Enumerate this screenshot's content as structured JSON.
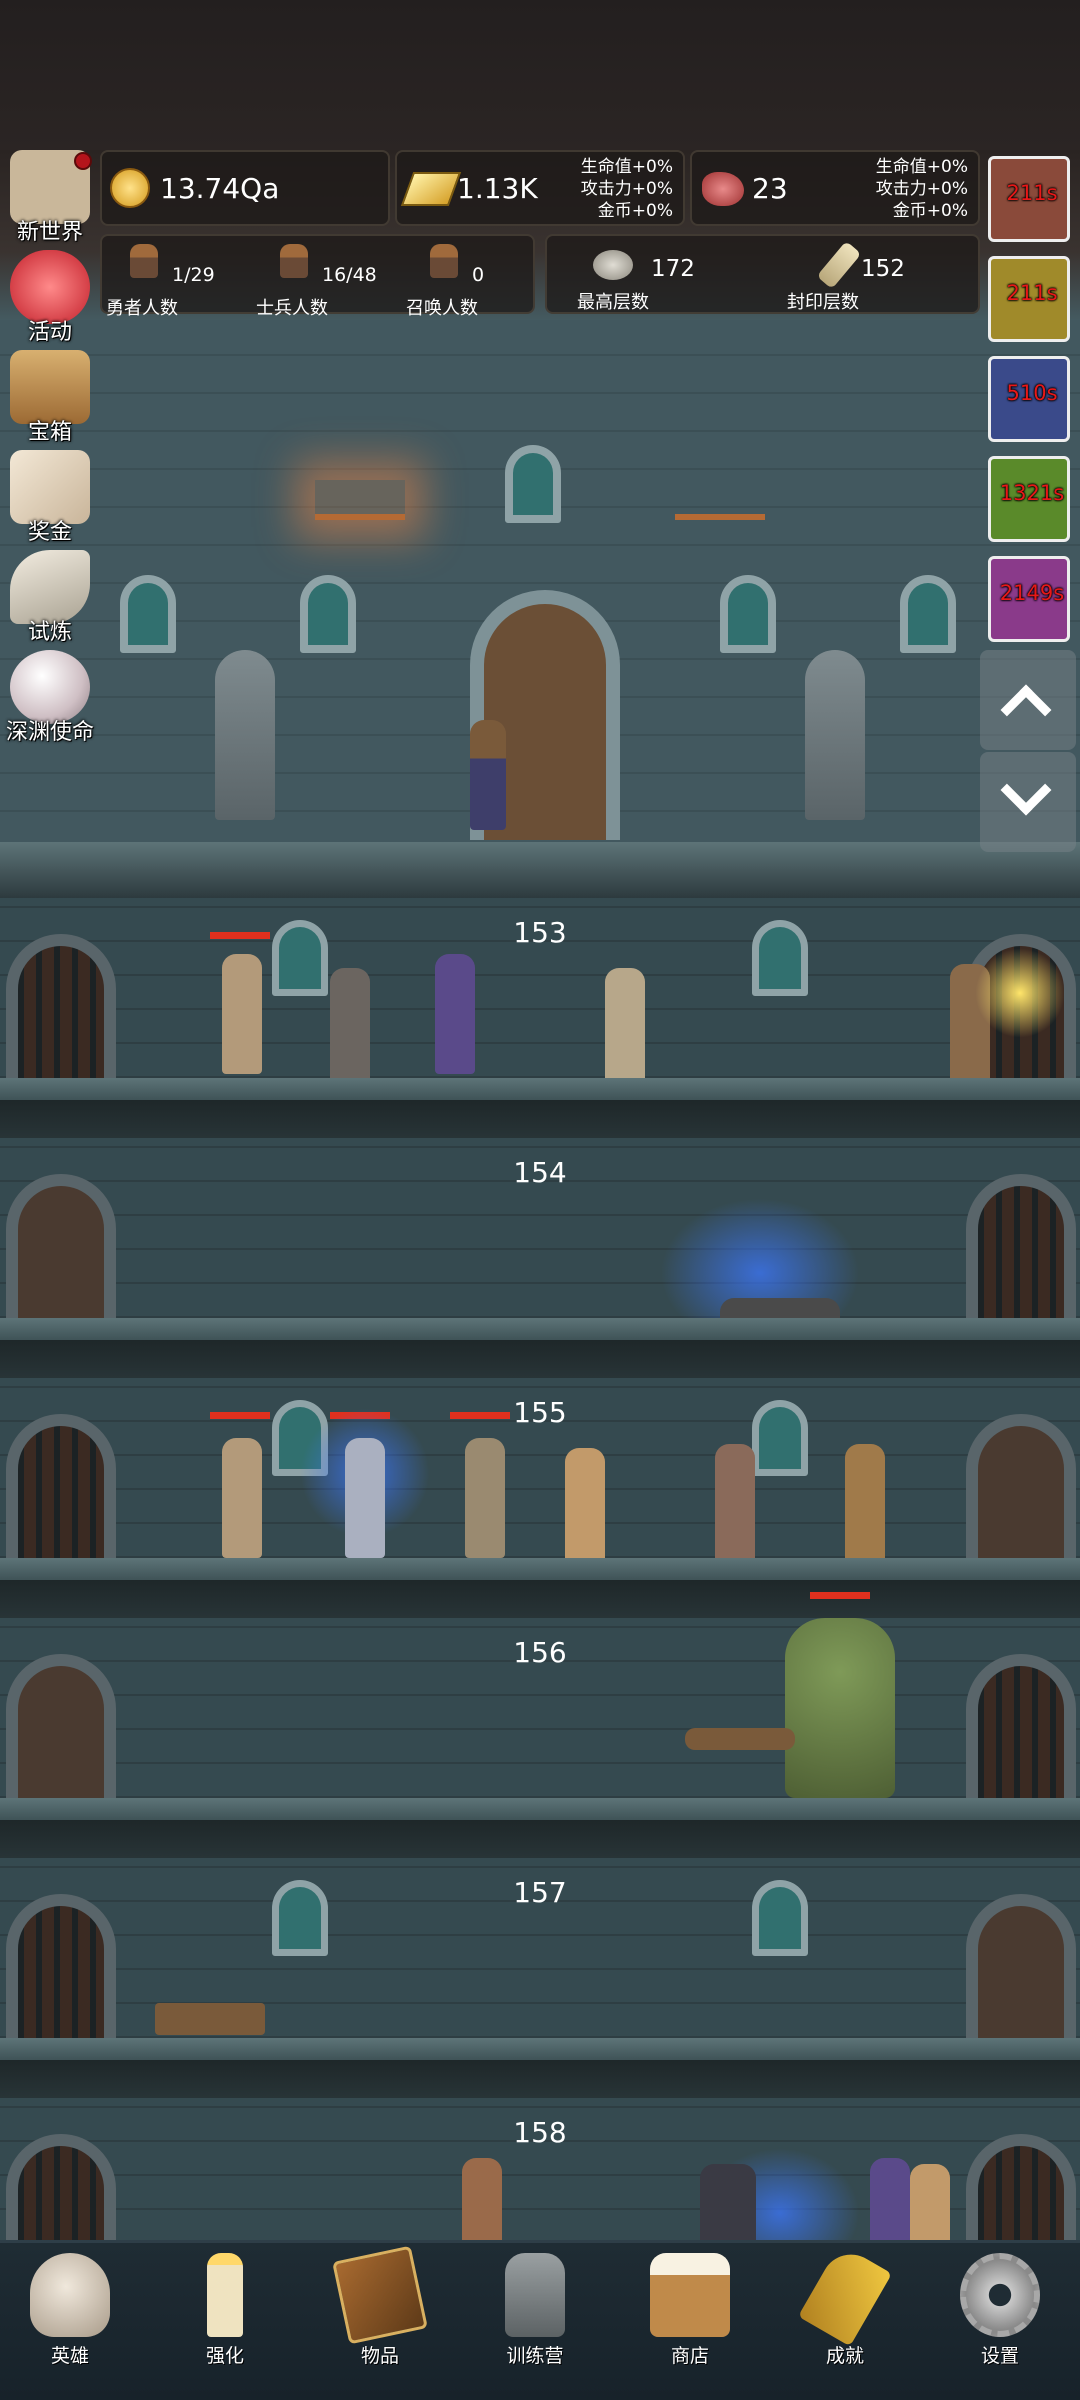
{
  "resources": {
    "coins": "13.74Qa",
    "gold": "1.13K",
    "gold_bonus": [
      "生命值+0%",
      "攻击力+0%",
      "金币+0%"
    ],
    "meat": "23",
    "meat_bonus": [
      "生命值+0%",
      "攻击力+0%",
      "金币+0%"
    ]
  },
  "stats": {
    "heroes": {
      "value": "1/29",
      "label": "勇者人数"
    },
    "soldiers": {
      "value": "16/48",
      "label": "士兵人数"
    },
    "summons": {
      "value": "0",
      "label": "召唤人数"
    },
    "highest_floor": {
      "value": "172",
      "label": "最高层数"
    },
    "sealed_floor": {
      "value": "152",
      "label": "封印层数"
    }
  },
  "left_menu": [
    {
      "label": "新世界",
      "icon": "map-icon",
      "color": "#c9b79a",
      "has_dot": true
    },
    {
      "label": "活动",
      "icon": "heart-icon",
      "color": "#e2454b",
      "has_dot": false
    },
    {
      "label": "宝箱",
      "icon": "chest-icon",
      "color": "#c69a5c",
      "has_dot": false
    },
    {
      "label": "奖金",
      "icon": "envelope-icon",
      "color": "#e8d9c2",
      "has_dot": false
    },
    {
      "label": "试炼",
      "icon": "wing-icon",
      "color": "#d9d2c2",
      "has_dot": false
    },
    {
      "label": "深渊使命",
      "icon": "pearl-icon",
      "color": "#e6d6d9",
      "has_dot": false
    }
  ],
  "buffs": [
    {
      "timer": "211s",
      "color": "#8a4a3a"
    },
    {
      "timer": "211s",
      "color": "#a08a2a"
    },
    {
      "timer": "510s",
      "color": "#3a4a8a"
    },
    {
      "timer": "1321s",
      "color": "#5a8a2a"
    },
    {
      "timer": "2149s",
      "color": "#8a3a8a"
    }
  ],
  "floors": [
    "153",
    "154",
    "155",
    "156",
    "157",
    "158"
  ],
  "bottom_nav": [
    {
      "label": "英雄",
      "icon": "skull-icon",
      "color": "#d8cfc0"
    },
    {
      "label": "强化",
      "icon": "candle-icon",
      "color": "#efe3c0"
    },
    {
      "label": "物品",
      "icon": "book-icon",
      "color": "#8a5a2a"
    },
    {
      "label": "训练营",
      "icon": "lantern-icon",
      "color": "#8a8f92"
    },
    {
      "label": "商店",
      "icon": "beer-mug-icon",
      "color": "#c08a4a"
    },
    {
      "label": "成就",
      "icon": "key-icon",
      "color": "#e0b030"
    },
    {
      "label": "设置",
      "icon": "gear-icon",
      "color": "#b0b0b0"
    }
  ]
}
